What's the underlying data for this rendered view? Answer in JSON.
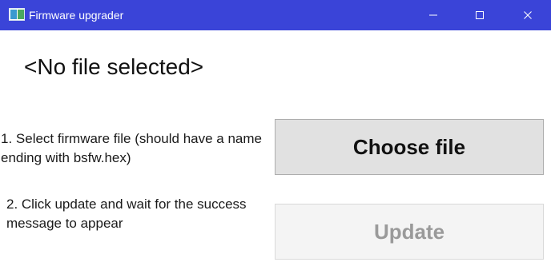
{
  "window": {
    "title": "Firmware upgrader",
    "icon": "app-window-icon",
    "controls": {
      "minimize_icon": "minimize-icon",
      "maximize_icon": "maximize-icon",
      "close_icon": "close-icon"
    }
  },
  "main": {
    "file_status": "<No file selected>",
    "step1_text": "1. Select firmware file (should have a name ending with bsfw.hex)",
    "step2_text": "2. Click update and wait for the success message to appear",
    "choose_button_label": "Choose file",
    "update_button_label": "Update",
    "update_button_enabled": false
  },
  "colors": {
    "titlebar": "#3a44d8",
    "choose_button_bg": "#e1e1e1",
    "update_button_bg_disabled": "#f4f4f4",
    "update_button_text_disabled": "#9a9a9a"
  }
}
